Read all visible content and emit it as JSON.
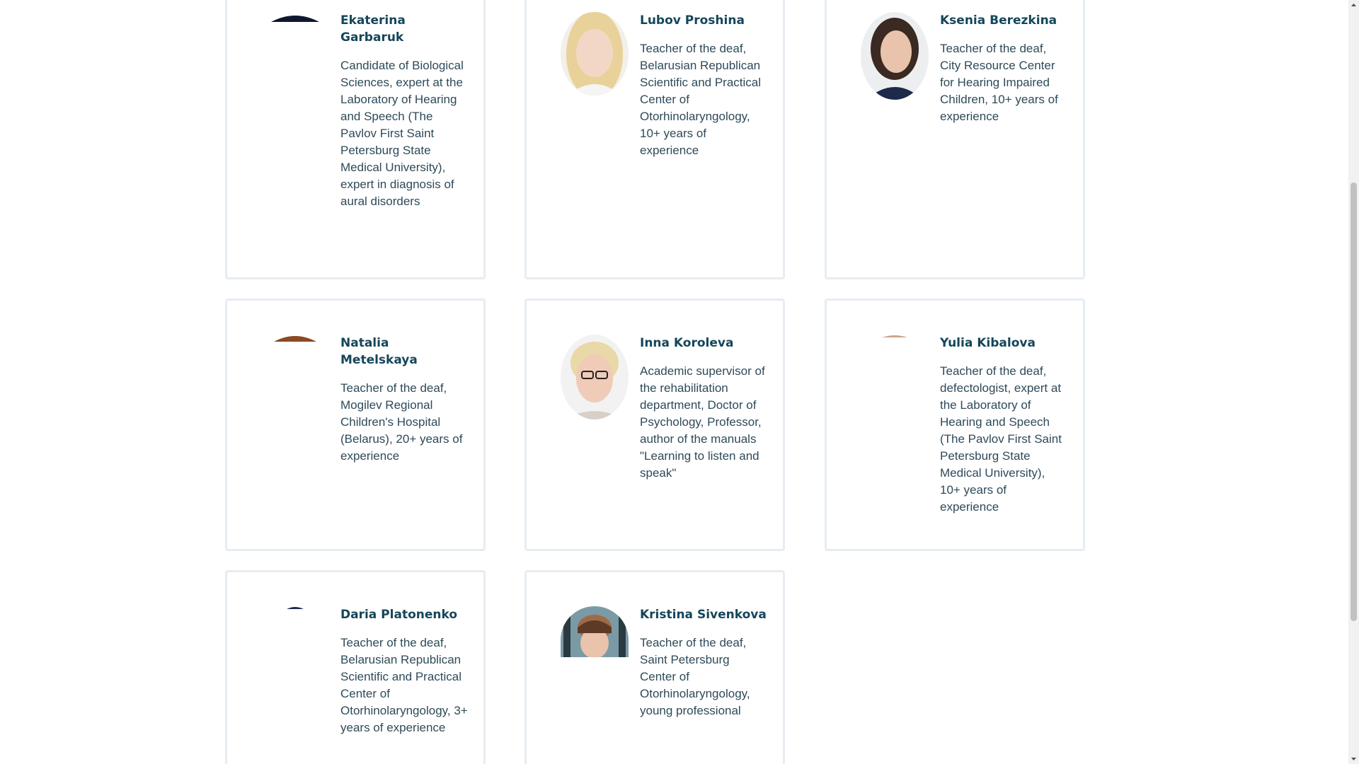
{
  "experts": [
    {
      "name": "Ekaterina Garbaruk",
      "description": "Candidate of Biological Sciences, expert at the Laboratory of Hearing and Speech (The Pavlov First Saint Petersburg State Medical University), expert in diagnosis of aural disorders"
    },
    {
      "name": "Lubov Proshina",
      "description": "Teacher of the deaf, Belarusian Republican Scientific and Practical Center of Otorhinolaryngology, 10+ years of experience"
    },
    {
      "name": "Ksenia Berezkina",
      "description": "Teacher of the deaf, City Resource Center for Hearing Impaired Children, 10+ years of experience"
    },
    {
      "name": "Natalia Metelskaya",
      "description": "Teacher of the deaf, Mogilev Regional Children's Hospital (Belarus), 20+ years of experience"
    },
    {
      "name": "Inna Koroleva",
      "description": "Academic supervisor of the rehabilitation department, Doctor of Psychology, Professor, author of the manuals \"Learning to listen and speak\""
    },
    {
      "name": "Yulia Kibalova",
      "description": "Teacher of the deaf, defectologist, expert at the Laboratory of Hearing and Speech (The Pavlov First Saint Petersburg State Medical University), 10+ years of experience"
    },
    {
      "name": "Daria Platonenko",
      "description": "Teacher of the deaf, Belarusian Republican Scientific and Practical Center of Otorhinolaryngology, 3+ years of experience"
    },
    {
      "name": "Kristina Sivenkova",
      "description": "Teacher of the deaf, Saint Petersburg Center of Otorhinolaryngology, young professional"
    }
  ],
  "colors": {
    "name": "#15465a",
    "text": "#2e4a59",
    "card_border": "#e6edf2"
  }
}
